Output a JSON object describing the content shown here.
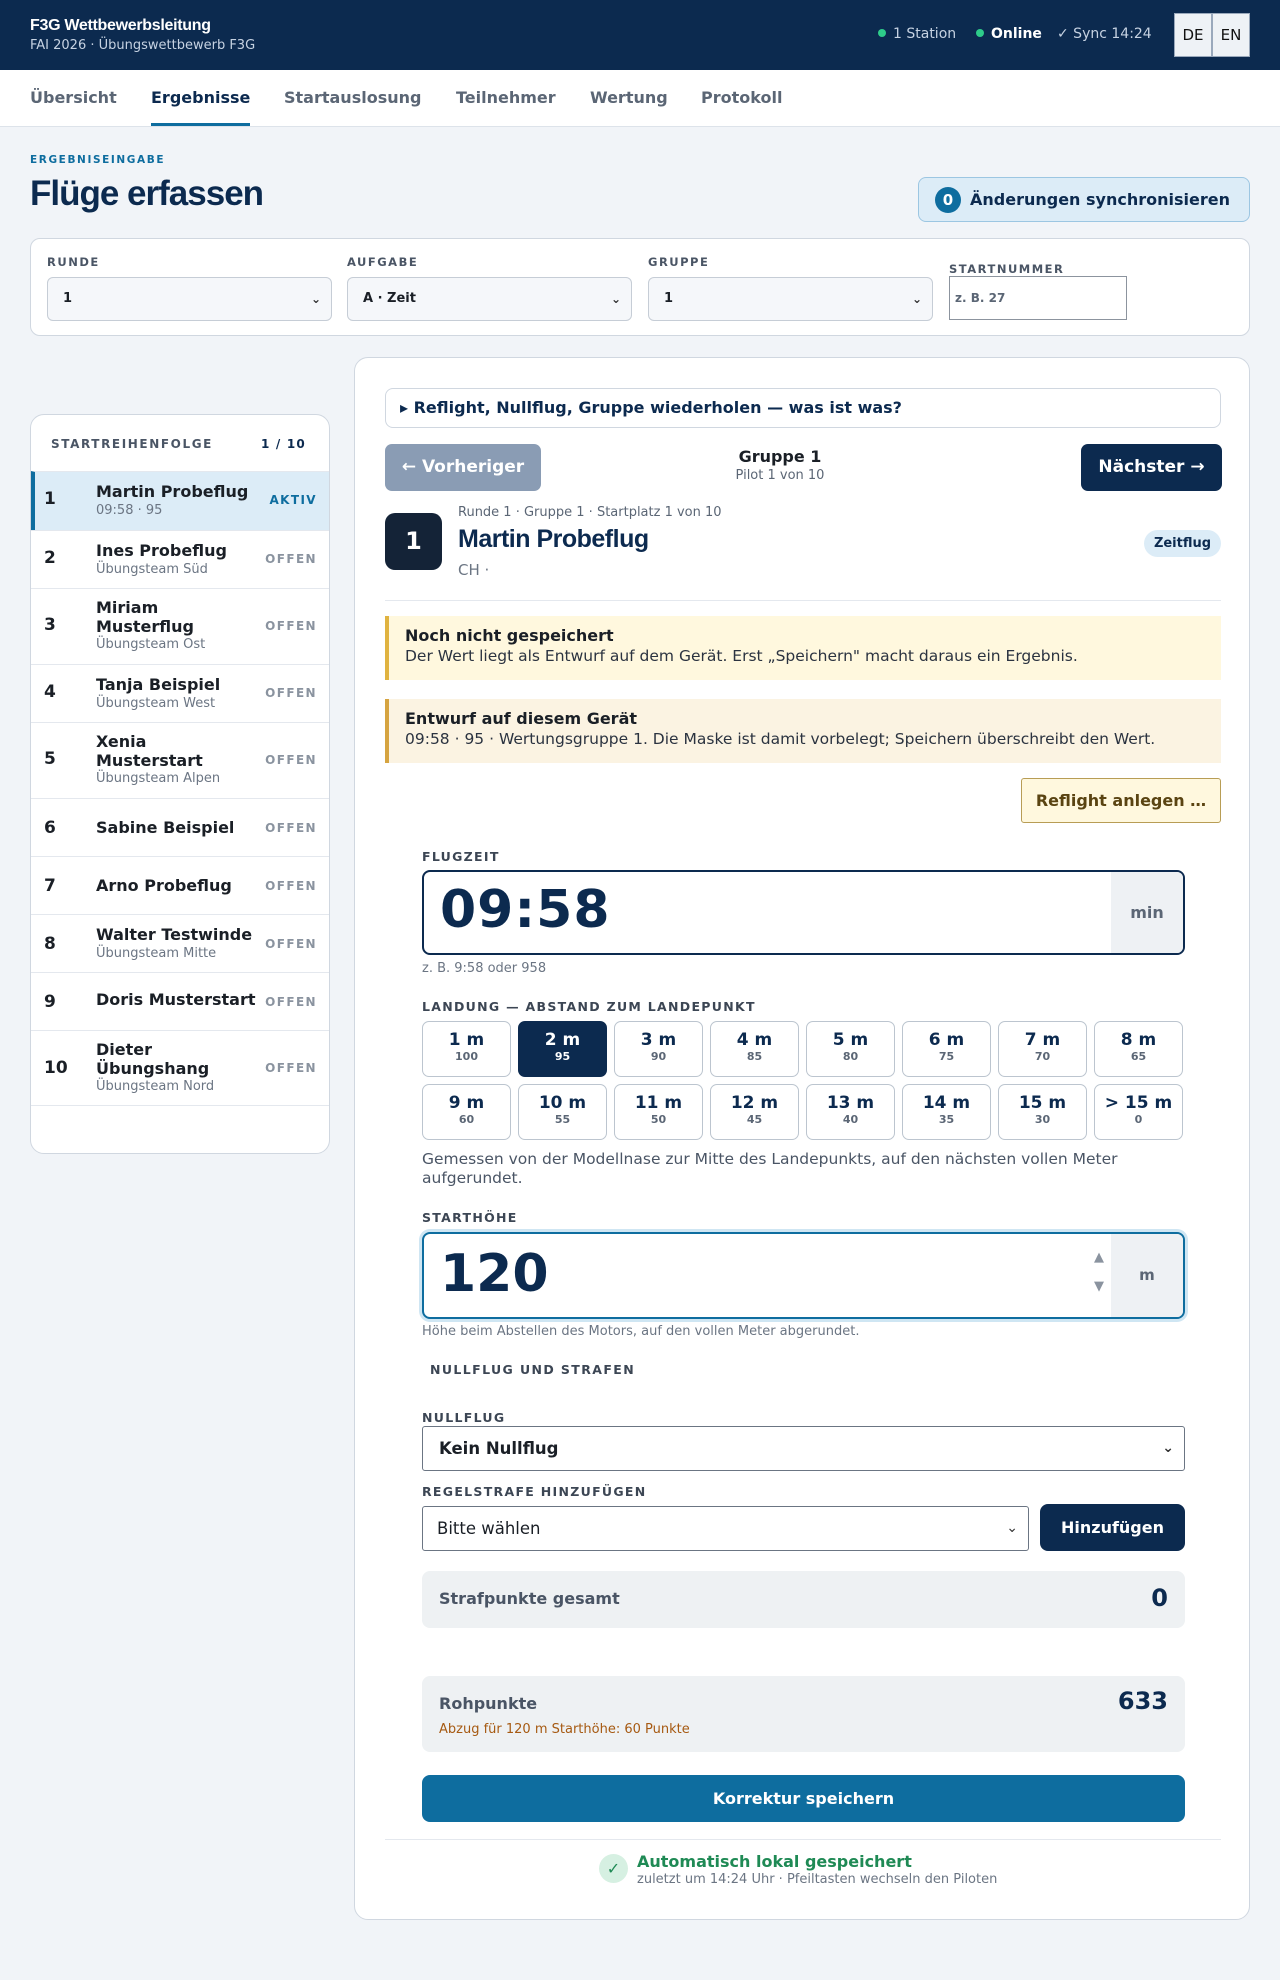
{
  "header": {
    "title": "F3G Wettbewerbsleitung",
    "subtitle": "FAI 2026 · Übungswettbewerb F3G",
    "station": "1 Station",
    "online": "Online",
    "sync": "✓ Sync 14:24",
    "lang_de": "DE",
    "lang_en": "EN"
  },
  "tabs": [
    "Übersicht",
    "Ergebnisse",
    "Startauslosung",
    "Teilnehmer",
    "Wertung",
    "Protokoll"
  ],
  "page": {
    "eyebrow": "ERGEBNISEINGABE",
    "title": "Flüge erfassen",
    "sync_count": "0",
    "sync_label": "Änderungen synchronisieren"
  },
  "filters": {
    "round_label": "RUNDE",
    "round_value": "1",
    "task_label": "AUFGABE",
    "task_value": "A · Zeit",
    "group_label": "GRUPPE",
    "group_value": "1",
    "start_label": "STARTNUMMER",
    "start_placeholder": "z. B. 27"
  },
  "sidebar": {
    "title": "STARTREIHENFOLGE",
    "count": "1 / 10",
    "items": [
      {
        "num": "1",
        "name": "Martin Probeflug",
        "sub": "09:58 · 95",
        "state": "AKTIV"
      },
      {
        "num": "2",
        "name": "Ines Probeflug",
        "sub": "Übungsteam Süd",
        "state": "OFFEN"
      },
      {
        "num": "3",
        "name": "Miriam Musterflug",
        "sub": "Übungsteam Ost",
        "state": "OFFEN"
      },
      {
        "num": "4",
        "name": "Tanja Beispiel",
        "sub": "Übungsteam West",
        "state": "OFFEN"
      },
      {
        "num": "5",
        "name": "Xenia Musterstart",
        "sub": "Übungsteam Alpen",
        "state": "OFFEN"
      },
      {
        "num": "6",
        "name": "Sabine Beispiel",
        "sub": "",
        "state": "OFFEN"
      },
      {
        "num": "7",
        "name": "Arno Probeflug",
        "sub": "",
        "state": "OFFEN"
      },
      {
        "num": "8",
        "name": "Walter Testwinde",
        "sub": "Übungsteam Mitte",
        "state": "OFFEN"
      },
      {
        "num": "9",
        "name": "Doris Musterstart",
        "sub": "",
        "state": "OFFEN"
      },
      {
        "num": "10",
        "name": "Dieter Übungshang",
        "sub": "Übungsteam Nord",
        "state": "OFFEN"
      }
    ]
  },
  "main": {
    "accordion": "▸ Reflight, Nullflug, Gruppe wiederholen — was ist was?",
    "prev": "← Vorheriger",
    "next": "Nächster →",
    "group_title": "Gruppe 1",
    "group_sub": "Pilot 1 von 10",
    "pilot_num": "1",
    "pilot_meta": "Runde 1 · Gruppe 1 · Startplatz 1 von 10",
    "pilot_name": "Martin Probeflug",
    "pilot_country": "CH ·",
    "pilot_badge": "Zeitflug",
    "alert1_title": "Noch nicht gespeichert",
    "alert1_body": "Der Wert liegt als Entwurf auf dem Gerät. Erst „Speichern\" macht daraus ein Ergebnis.",
    "alert2_title": "Entwurf auf diesem Gerät",
    "alert2_body": "09:58 · 95 · Wertungsgruppe 1. Die Maske ist damit vorbelegt; Speichern überschreibt den Wert.",
    "reflight": "Reflight anlegen …",
    "flighttime_label": "FLUGZEIT",
    "flighttime_value": "09:58",
    "flighttime_unit": "min",
    "flighttime_hint": "z. B. 9:58 oder 958",
    "landing_label": "LANDUNG — ABSTAND ZUM LANDEPUNKT",
    "landing_selected": "2 m",
    "landing_options": [
      {
        "m": "1 m",
        "p": "100"
      },
      {
        "m": "2 m",
        "p": "95"
      },
      {
        "m": "3 m",
        "p": "90"
      },
      {
        "m": "4 m",
        "p": "85"
      },
      {
        "m": "5 m",
        "p": "80"
      },
      {
        "m": "6 m",
        "p": "75"
      },
      {
        "m": "7 m",
        "p": "70"
      },
      {
        "m": "8 m",
        "p": "65"
      },
      {
        "m": "9 m",
        "p": "60"
      },
      {
        "m": "10 m",
        "p": "55"
      },
      {
        "m": "11 m",
        "p": "50"
      },
      {
        "m": "12 m",
        "p": "45"
      },
      {
        "m": "13 m",
        "p": "40"
      },
      {
        "m": "14 m",
        "p": "35"
      },
      {
        "m": "15 m",
        "p": "30"
      },
      {
        "m": "> 15 m",
        "p": "0"
      }
    ],
    "landing_desc": "Gemessen von der Modellnase zur Mitte des Landepunkts, auf den nächsten vollen Meter aufgerundet.",
    "height_label": "STARTHÖHE",
    "height_value": "120",
    "height_unit": "m",
    "height_hint": "Höhe beim Abstellen des Motors, auf den vollen Meter abgerundet.",
    "penalties_head": "NULLFLUG UND STRAFEN",
    "nullflug_label": "NULLFLUG",
    "nullflug_value": "Kein Nullflug",
    "penalty_label": "REGELSTRAFE HINZUFÜGEN",
    "penalty_value": "Bitte wählen",
    "penalty_add": "Hinzufügen",
    "penalty_total_label": "Strafpunkte gesamt",
    "penalty_total": "0",
    "raw_label": "Rohpunkte",
    "raw_value": "633",
    "raw_note": "Abzug für 120 m Starthöhe: 60 Punkte",
    "save": "Korrektur speichern",
    "autosave_title": "Automatisch lokal gespeichert",
    "autosave_sub": "zuletzt um 14:24 Uhr · Pfeiltasten wechseln den Piloten"
  }
}
